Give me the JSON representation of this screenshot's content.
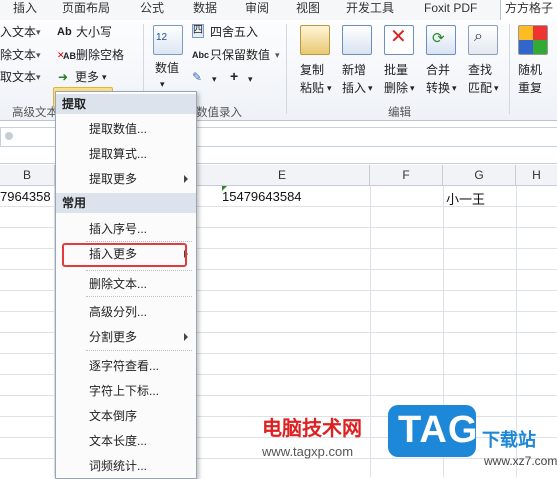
{
  "tabs": [
    "插入",
    "页面布局",
    "公式",
    "数据",
    "审阅",
    "视图",
    "开发工具",
    "Foxit PDF",
    "方方格子"
  ],
  "ribbon": {
    "left_items": [
      "入文本",
      "除文本",
      "取文本"
    ],
    "group_high_text": "高级文本",
    "case_btn": "大小写",
    "del_space_btn": "删除空格",
    "more_btn": "更多",
    "number_btn": "数值",
    "round_btn": "四舍五入",
    "keep_num_btn": "只保留数值",
    "group_numeric": "数值录入",
    "copy_paste": [
      "复制",
      "粘贴"
    ],
    "new_insert": [
      "新增",
      "插入"
    ],
    "bulk_delete": [
      "批量",
      "删除"
    ],
    "merge_convert": [
      "合并",
      "转换"
    ],
    "find_match": [
      "查找",
      "匹配"
    ],
    "random_repeat": [
      "随机",
      "重复"
    ],
    "group_edit": "编辑",
    "case_icon_text": "Ab",
    "space_icon_text": "AB",
    "round_icon_text": "四舍",
    "keep_icon_text": "Abc"
  },
  "sheet": {
    "cols": [
      "B",
      "",
      "E",
      "F",
      "G",
      "H"
    ],
    "cell_b": "7964358",
    "cell_e": "15479643584",
    "cell_g": "小一王"
  },
  "menu": {
    "head_extract": "提取",
    "extract_items": [
      "提取数值...",
      "提取算式...",
      "提取更多"
    ],
    "head_common": "常用",
    "common_items": [
      "插入序号...",
      "插入更多",
      "删除文本...",
      "高级分列...",
      "分割更多",
      "逐字符查看...",
      "字符上下标...",
      "文本倒序",
      "文本长度...",
      "词频统计..."
    ]
  },
  "watermark": {
    "title": "电脑技术网",
    "url": "www.tagxp.com",
    "logo": "TAG",
    "dl": "下载站",
    "dl_url": "www.xz7.com"
  },
  "colors": {
    "highlight": "#e23b3b",
    "watermark_red": "#e02020",
    "logo_blue": "#1e88d8"
  }
}
